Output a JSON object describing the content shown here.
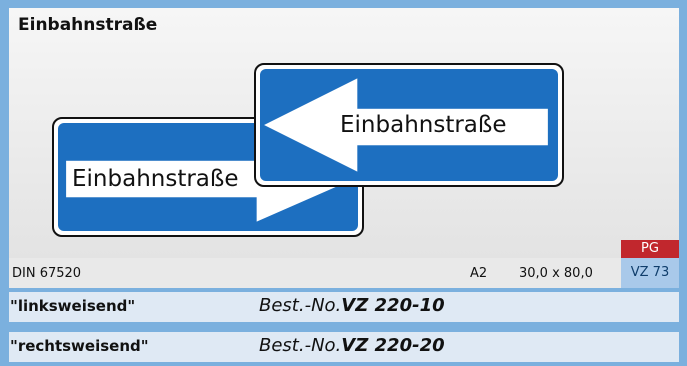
{
  "header": {
    "title": "Einbahnstraße"
  },
  "signs": [
    {
      "text": "Einbahnstraße",
      "direction": "right"
    },
    {
      "text": "Einbahnstraße",
      "direction": "left"
    }
  ],
  "info": {
    "din": "DIN 67520",
    "size": "A2",
    "dimensions": "30,0 x 80,0",
    "code": "VZ 73",
    "badge": "PG"
  },
  "variants": [
    {
      "label": "\"linksweisend\"",
      "order_prefix": "Best.-No.",
      "order_number": "VZ 220-10"
    },
    {
      "label": "\"rechtsweisend\"",
      "order_prefix": "Best.-No.",
      "order_number": "VZ 220-20"
    }
  ],
  "colors": {
    "sign_blue": "#1d6fc0",
    "badge_red": "#c1272d",
    "background": "#7bb0de"
  }
}
